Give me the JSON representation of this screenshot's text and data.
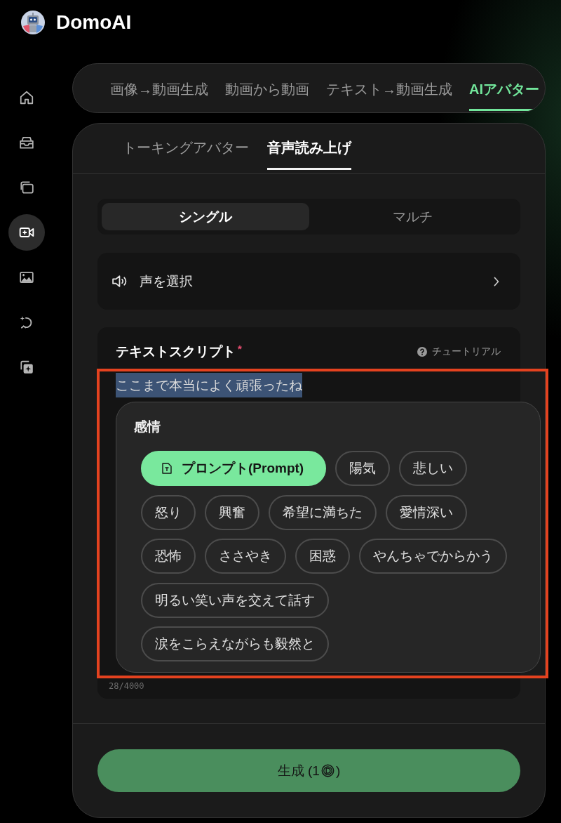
{
  "header": {
    "brand": "DomoAI"
  },
  "sidebar": {
    "items": [
      {
        "selected": false
      },
      {
        "selected": false
      },
      {
        "selected": false
      },
      {
        "selected": true
      },
      {
        "selected": false
      },
      {
        "selected": false
      },
      {
        "selected": false
      }
    ]
  },
  "mode_tabs": [
    {
      "label": "画像→動画生成",
      "selected": false
    },
    {
      "label": "動画から動画",
      "selected": false
    },
    {
      "label": "テキスト→動画生成",
      "selected": false
    },
    {
      "label": "AIアバター",
      "selected": true
    }
  ],
  "avatar_tabs": [
    {
      "label": "トーキングアバター",
      "selected": false
    },
    {
      "label": "音声読み上げ",
      "selected": true
    }
  ],
  "speaker_mode": [
    {
      "label": "シングル",
      "selected": true
    },
    {
      "label": "マルチ",
      "selected": false
    }
  ],
  "voice_select": {
    "label": "声を選択"
  },
  "text_script": {
    "title": "テキストスクリプト",
    "required_mark": "*",
    "tutorial": "チュートリアル",
    "value": "ここまで本当によく頑張ったね",
    "highlighted": true,
    "counter": "28/4000"
  },
  "emotion_popover": {
    "title": "感情",
    "chips": [
      {
        "label": "プロンプト(Prompt)",
        "kind": "prompt",
        "selected": true
      },
      {
        "label": "陽気",
        "kind": "emotion",
        "selected": false
      },
      {
        "label": "悲しい",
        "kind": "emotion",
        "selected": false
      },
      {
        "label": "怒り",
        "kind": "emotion",
        "selected": false
      },
      {
        "label": "興奮",
        "kind": "emotion",
        "selected": false
      },
      {
        "label": "希望に満ちた",
        "kind": "emotion",
        "selected": false
      },
      {
        "label": "愛情深い",
        "kind": "emotion",
        "selected": false
      },
      {
        "label": "恐怖",
        "kind": "emotion",
        "selected": false
      },
      {
        "label": "ささやき",
        "kind": "emotion",
        "selected": false
      },
      {
        "label": "困惑",
        "kind": "emotion",
        "selected": false
      },
      {
        "label": "やんちゃでからかう",
        "kind": "emotion",
        "selected": false
      },
      {
        "label": "明るい笑い声を交えて話す",
        "kind": "emotion",
        "selected": false
      },
      {
        "label": "涙をこらえながらも毅然と",
        "kind": "emotion",
        "selected": false
      }
    ]
  },
  "generate_button": {
    "label": "生成 (1",
    "suffix": ")"
  }
}
